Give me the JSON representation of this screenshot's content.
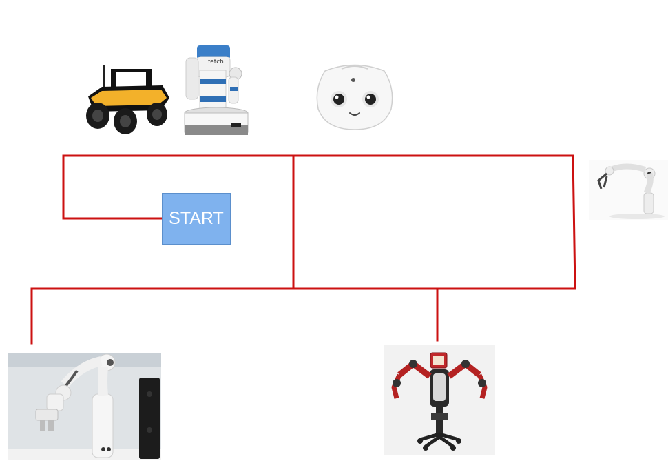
{
  "diagram": {
    "start_label": "START",
    "line_color": "#cc1111",
    "start_fill": "#7fb2ee",
    "nodes": [
      {
        "name": "jackal-robot-icon"
      },
      {
        "name": "fetch-robot-icon"
      },
      {
        "name": "pepper-head-icon"
      },
      {
        "name": "robot-arm-icon"
      },
      {
        "name": "franka-panda-icon"
      },
      {
        "name": "baxter-robot-icon"
      }
    ]
  }
}
